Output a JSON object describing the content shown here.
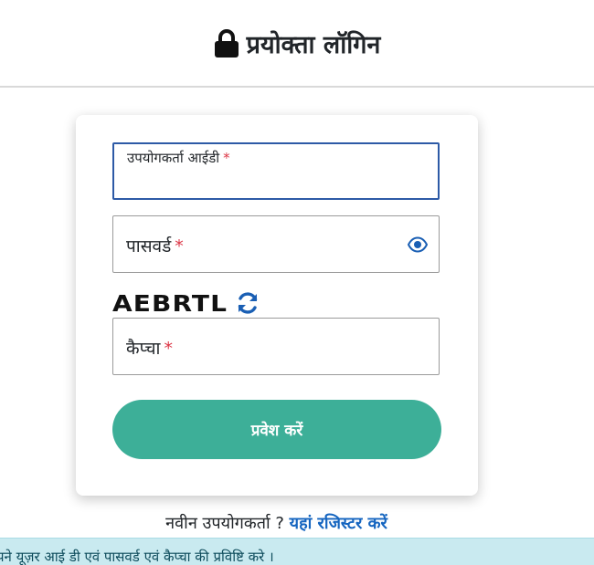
{
  "header": {
    "title": "प्रयोक्ता लॉगिन",
    "icon": "lock-icon"
  },
  "login_form": {
    "user_id": {
      "label": "उपयोगकर्ता आईडी",
      "required_mark": "*",
      "value": ""
    },
    "password": {
      "label": "पासवर्ड",
      "required_mark": "*",
      "value": "",
      "toggle_icon": "eye-icon"
    },
    "captcha": {
      "image_text": "AEBRTL",
      "refresh_icon": "refresh-icon",
      "label": "कैप्चा",
      "required_mark": "*",
      "value": ""
    },
    "submit_label": "प्रवेश करें"
  },
  "register": {
    "prompt": "नवीन उपयोगकर्ता ?",
    "link_label": "यहां रजिस्टर करें"
  },
  "alert": {
    "message": "पने यूज़र आई डी एवं पासवर्ड एवं कैप्चा की प्रविष्टि करे ।"
  },
  "colors": {
    "accent": "#3daf98",
    "focus_border": "#2d5aa6",
    "link": "#1565c0",
    "required": "#dc3545",
    "alert_bg": "#c9eaf0"
  }
}
